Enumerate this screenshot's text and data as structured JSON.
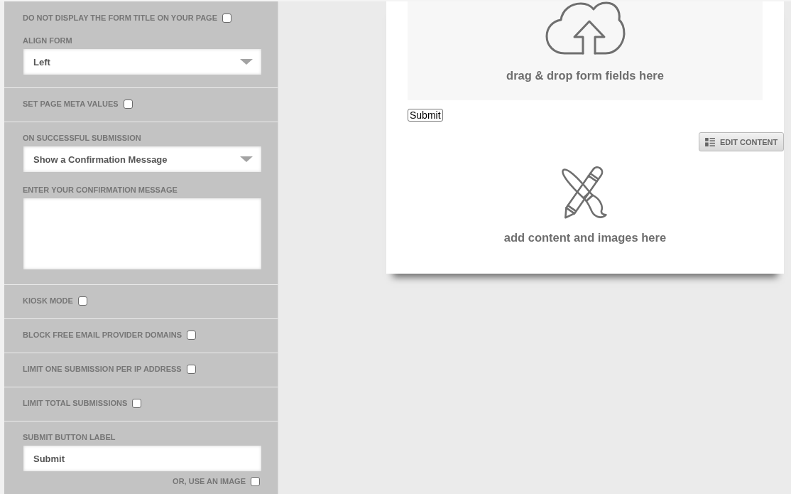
{
  "settings_panel": {
    "sections": [
      {
        "fields": [
          {
            "kind": "checkbox",
            "label": "DO NOT DISPLAY THE FORM TITLE ON YOUR PAGE",
            "checked": false
          },
          {
            "kind": "select",
            "label": "ALIGN FORM",
            "value": "Left"
          }
        ]
      },
      {
        "fields": [
          {
            "kind": "checkbox",
            "label": "SET PAGE META VALUES",
            "checked": false
          }
        ]
      },
      {
        "fields": [
          {
            "kind": "select",
            "label": "ON SUCCESSFUL SUBMISSION",
            "value": "Show a Confirmation Message"
          },
          {
            "kind": "textarea",
            "label": "ENTER YOUR CONFIRMATION MESSAGE"
          }
        ]
      },
      {
        "fields": [
          {
            "kind": "checkbox",
            "label": "KIOSK MODE",
            "checked": false
          }
        ]
      },
      {
        "fields": [
          {
            "kind": "checkbox",
            "label": "BLOCK FREE EMAIL PROVIDER DOMAINS",
            "checked": false
          }
        ]
      },
      {
        "fields": [
          {
            "kind": "checkbox",
            "label": "LIMIT ONE SUBMISSION PER IP ADDRESS",
            "checked": false
          }
        ]
      },
      {
        "fields": [
          {
            "kind": "checkbox",
            "label": "LIMIT TOTAL SUBMISSIONS",
            "checked": false
          }
        ]
      },
      {
        "fields": [
          {
            "kind": "text",
            "label": "SUBMIT BUTTON LABEL",
            "value": "Submit"
          },
          {
            "kind": "suboption",
            "label": "OR, USE AN IMAGE",
            "checked": false
          }
        ]
      }
    ]
  },
  "preview": {
    "dropzone": {
      "text": "drag & drop form fields here"
    },
    "submit_button": {
      "label": "Submit"
    },
    "edit_button": {
      "label": "EDIT CONTENT"
    },
    "content_zone": {
      "text": "add content and images here"
    }
  }
}
